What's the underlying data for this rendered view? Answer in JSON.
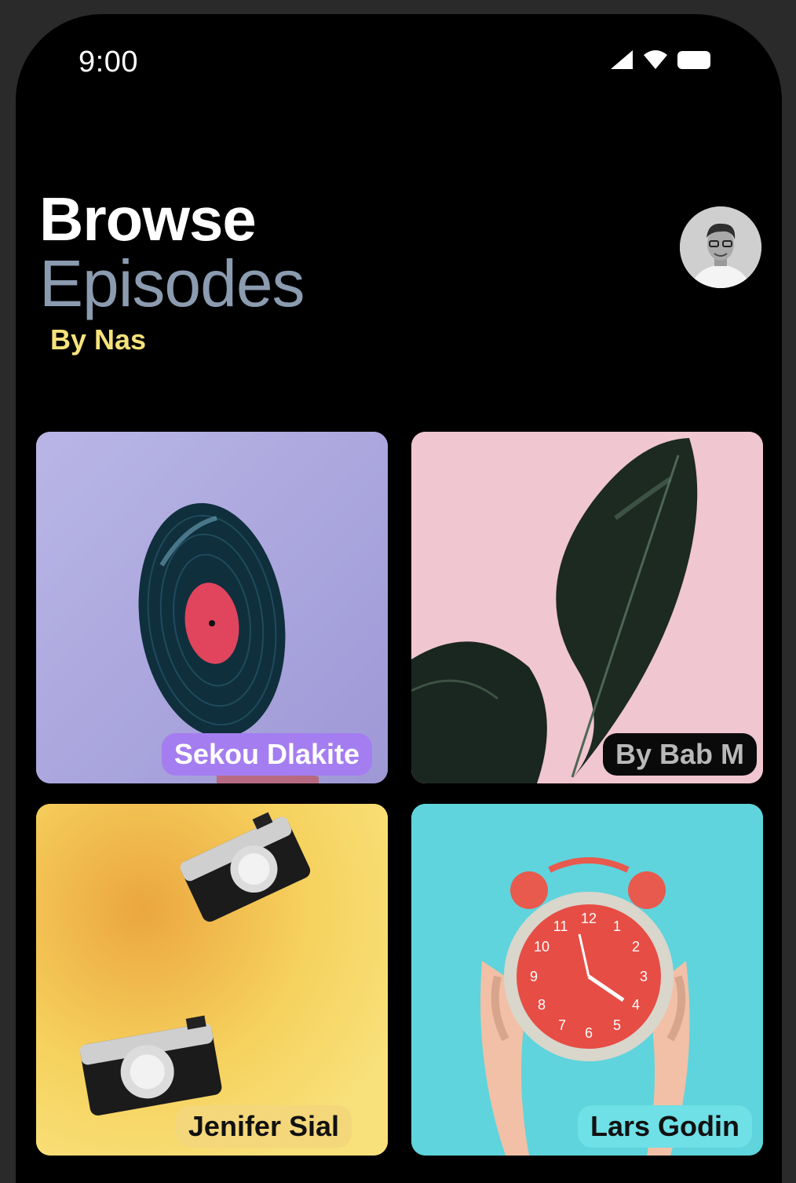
{
  "status_bar": {
    "time": "9:00",
    "icons": [
      "signal-icon",
      "wifi-icon",
      "battery-icon"
    ]
  },
  "header": {
    "title_line1": "Browse",
    "title_line2": "Episodes",
    "subtitle": "By Nas"
  },
  "colors": {
    "background": "#000000",
    "title_primary": "#ffffff",
    "title_secondary": "#8b9bb0",
    "subtitle": "#f6e27a"
  },
  "episodes": [
    {
      "image": "vinyl-record-image",
      "label": "Sekou Dlakite",
      "label_bg": "#a47df0"
    },
    {
      "image": "rubber-plant-leaf-image",
      "label": "By Bab M",
      "label_bg": "#0a0a0a"
    },
    {
      "image": "cameras-image",
      "label": "Jenifer Sial",
      "label_bg": "#f3d77a"
    },
    {
      "image": "alarm-clock-image",
      "label": "Lars Godin",
      "label_bg": "#6ee0e6"
    }
  ]
}
